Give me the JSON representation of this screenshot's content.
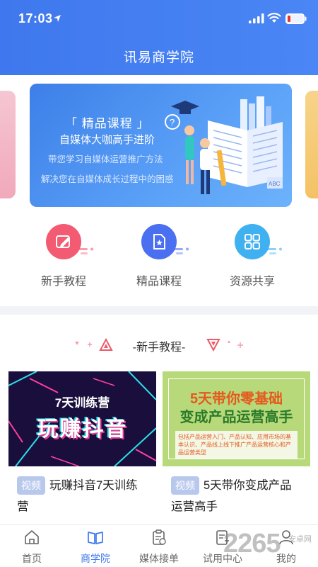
{
  "status": {
    "time": "17:03"
  },
  "header": {
    "title": "讯易商学院"
  },
  "banner": {
    "tag": "「 精品课程 」",
    "subtitle": "自媒体大咖高手进阶",
    "line1": "带您学习自媒体运营推广方法",
    "line2": "解决您在自媒体成长过程中的困惑",
    "illustration_text": "ABC"
  },
  "quick_menu": [
    {
      "label": "新手教程",
      "icon": "pen-icon",
      "color": "#f25b72"
    },
    {
      "label": "精品课程",
      "icon": "star-doc-icon",
      "color": "#4a6ff0"
    },
    {
      "label": "资源共享",
      "icon": "grid-icon",
      "color": "#3fb0f0"
    }
  ],
  "section": {
    "title": "-新手教程-"
  },
  "courses": [
    {
      "tag": "视频",
      "title": "玩赚抖音7天训练营",
      "thumb_top": "7天训练营",
      "thumb_main": "玩赚抖音"
    },
    {
      "tag": "视频",
      "title": "5天带你变成产品运营高手",
      "thumb_line1": "5天带你零基础",
      "thumb_line2": "变成产品运营高手",
      "thumb_note": "包括产品运营入门、产品认知、应用市场的基本认识、产品线上线下推广产品运营核心和产品运营类型"
    }
  ],
  "tabbar": [
    {
      "label": "首页",
      "icon": "home-icon",
      "active": false
    },
    {
      "label": "商学院",
      "icon": "book-icon",
      "active": true
    },
    {
      "label": "媒体接单",
      "icon": "clipboard-icon",
      "active": false
    },
    {
      "label": "试用中心",
      "icon": "trial-icon",
      "active": false
    },
    {
      "label": "我的",
      "icon": "user-icon",
      "active": false
    }
  ],
  "watermark": {
    "main": "2265",
    "sub": "安卓网"
  },
  "colors": {
    "primary": "#3f78ee",
    "tab_active": "#3f78ee",
    "tab_inactive": "#666666"
  }
}
